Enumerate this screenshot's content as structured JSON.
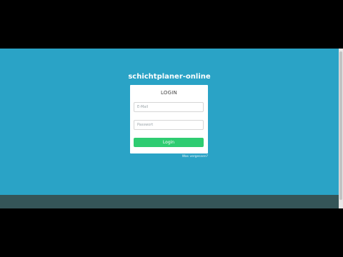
{
  "app": {
    "title": "schichtplaner-online"
  },
  "login": {
    "heading": "LOGIN",
    "email_placeholder": "E-Mail",
    "password_placeholder": "Passwort",
    "button_label": "Login",
    "forgot_label": "Was vergessen?"
  },
  "colors": {
    "background": "#2aa3c6",
    "footer": "#355558",
    "button": "#2ecc71",
    "card": "#ffffff"
  }
}
